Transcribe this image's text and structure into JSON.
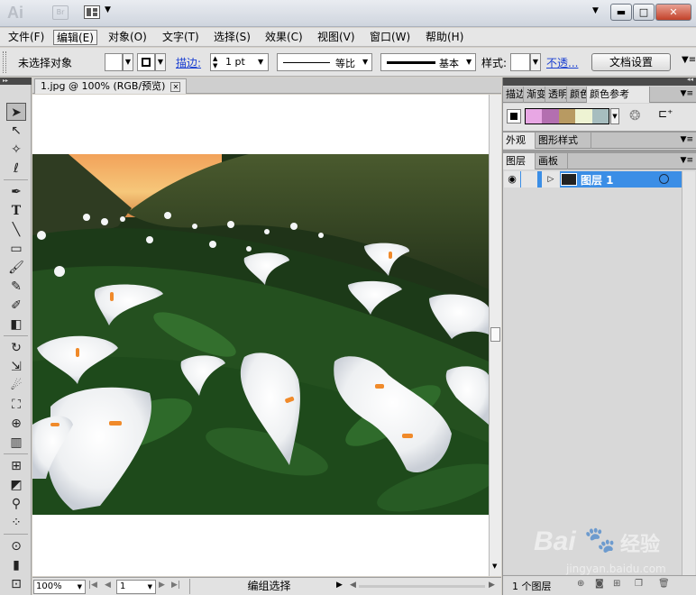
{
  "titlebar": {
    "app_logo": "Ai",
    "bridge_label": "Br",
    "window_buttons": {
      "minimize": "▬",
      "maximize": "□",
      "close": "✕"
    }
  },
  "menu": {
    "items": [
      "文件(F)",
      "编辑(E)",
      "对象(O)",
      "文字(T)",
      "选择(S)",
      "效果(C)",
      "视图(V)",
      "窗口(W)",
      "帮助(H)"
    ],
    "active_index": 1
  },
  "controlbar": {
    "selection_label": "未选择对象",
    "stroke_label": "描边:",
    "stroke_weight": "1 pt",
    "stroke_profile_label": "等比",
    "brush_label": "基本",
    "style_label": "样式:",
    "opacity_label": "不透...",
    "doc_setup_button": "文档设置",
    "fill_color": "#ffffff",
    "stroke_color": "#000000"
  },
  "document": {
    "tab_title": "1.jpg @ 100% (RGB/预览)",
    "tab_close": "✕"
  },
  "statusbar": {
    "zoom": "100%",
    "artboard_number": "1",
    "status_text": "编组选择"
  },
  "panels": {
    "top_tabs": [
      "描边",
      "渐变",
      "透明",
      "颜色",
      "颜色参考"
    ],
    "top_active_index": 4,
    "color_guide_swatches": [
      "#e8a7e4",
      "#b36fb0",
      "#b89a62",
      "#eef3d3",
      "#a7bdbf"
    ],
    "appearance_tabs": [
      "外观",
      "图形样式"
    ],
    "appearance_active_index": 0,
    "layers_tabs": [
      "图层",
      "画板"
    ],
    "layers_active_index": 0,
    "layers": [
      {
        "name": "图层 1"
      }
    ],
    "layers_count": "1 个图层",
    "layer_color": "#3b8ee6"
  },
  "watermark": {
    "brand": "Bai",
    "brand_cn": "经验",
    "url": "jingyan.baidu.com"
  }
}
